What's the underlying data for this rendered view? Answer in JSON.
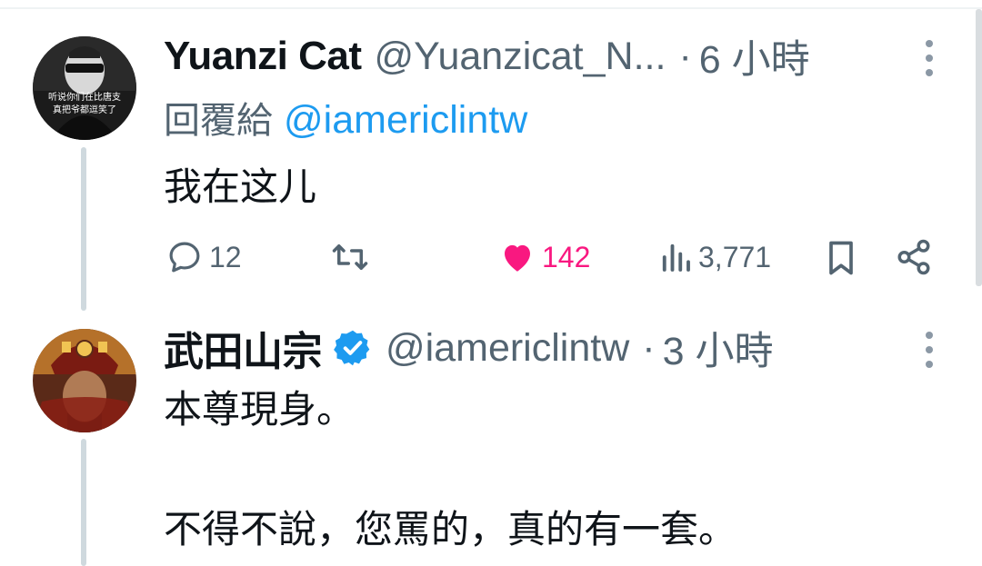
{
  "tweets": [
    {
      "author_name": "Yuanzi Cat",
      "handle": "@Yuanzicat_N...",
      "separator": "·",
      "time": "6 小時",
      "reply_prefix": "回覆給",
      "reply_mention": "@iamericlintw",
      "text": "我在这儿",
      "avatar_text_line1": "听说你们在比唐支",
      "avatar_text_line2": "真把爷都逗笑了",
      "actions": {
        "reply_count": "12",
        "retweet_count": "",
        "like_count": "142",
        "view_count": "3,771"
      },
      "liked": true
    },
    {
      "author_name": "武田山宗",
      "handle": "@iamericlintw",
      "separator": "·",
      "time": "3 小時",
      "verified": true,
      "text_line1": "本尊現身。",
      "text_line2": "不得不說，您罵的，真的有一套。"
    }
  ],
  "colors": {
    "accent": "#1d9bf0",
    "like": "#f91880",
    "secondary_text": "#536471",
    "thread_line": "#cfd9de"
  },
  "icons": [
    "reply-icon",
    "retweet-icon",
    "heart-icon",
    "views-icon",
    "bookmark-icon",
    "share-icon",
    "more-icon",
    "verified-badge-icon"
  ]
}
